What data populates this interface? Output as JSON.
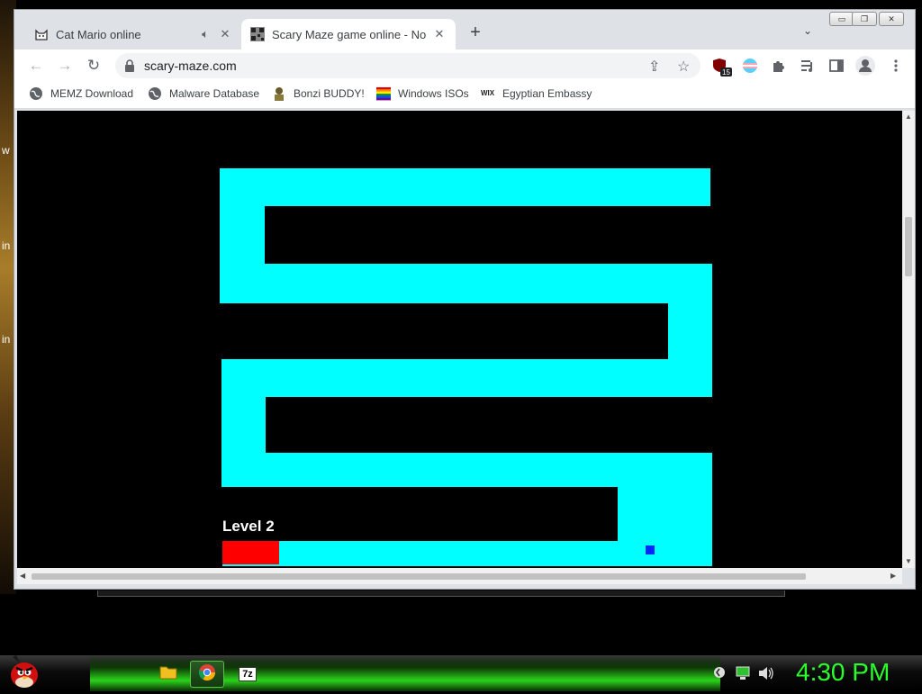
{
  "desktop": {
    "fragment_1": "w",
    "fragment_2": "in",
    "fragment_3": "in"
  },
  "browser": {
    "tabs": [
      {
        "title": "Cat Mario online",
        "favicon": "cat-icon",
        "audio": "speaker-icon"
      },
      {
        "title": "Scary Maze game online - No ov",
        "favicon": "qr-icon",
        "active": true
      }
    ],
    "new_tab": "+",
    "tab_search": "⌄",
    "window_controls": {
      "minimize": "▭",
      "restore": "❐",
      "close": "✕"
    },
    "toolbar": {
      "back": "←",
      "forward": "→",
      "reload": "↻",
      "url": "scary-maze.com",
      "share": "⇪",
      "bookmark_star": "☆",
      "extension_badge": "15"
    },
    "bookmarks": [
      {
        "label": "MEMZ Download",
        "icon": "globe-icon"
      },
      {
        "label": "Malware Database",
        "icon": "globe-icon"
      },
      {
        "label": "Bonzi BUDDY!",
        "icon": "bonzi-icon"
      },
      {
        "label": "Windows ISOs",
        "icon": "rainbow-flag-icon"
      },
      {
        "label": "Egyptian Embassy",
        "icon": "wix-icon"
      }
    ]
  },
  "game": {
    "level_label": "Level 2",
    "colors": {
      "background": "#000000",
      "path": "#00ffff",
      "start": "#ff0000",
      "player": "#0028ff"
    }
  },
  "taskbar": {
    "clock": "4:30 PM",
    "items": [
      "folder-icon",
      "chrome-icon",
      "7zip-icon"
    ],
    "seven_zip_label": "7z",
    "tray": [
      "keyboard-icon",
      "network-icon",
      "volume-icon"
    ]
  }
}
